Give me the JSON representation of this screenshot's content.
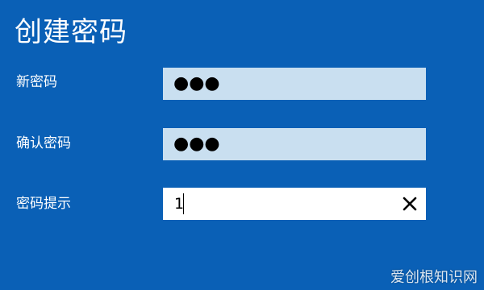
{
  "page": {
    "title": "创建密码"
  },
  "fields": {
    "new_password": {
      "label": "新密码",
      "masked_value": "●●●"
    },
    "confirm_password": {
      "label": "确认密码",
      "masked_value": "●●●"
    },
    "password_hint": {
      "label": "密码提示",
      "value": "1",
      "clear_icon": "close-icon"
    }
  },
  "watermark": "爱创根知识网",
  "colors": {
    "background": "#0a60b6",
    "field_filled": "#c9dff0",
    "field_active": "#ffffff",
    "text": "#ffffff"
  }
}
